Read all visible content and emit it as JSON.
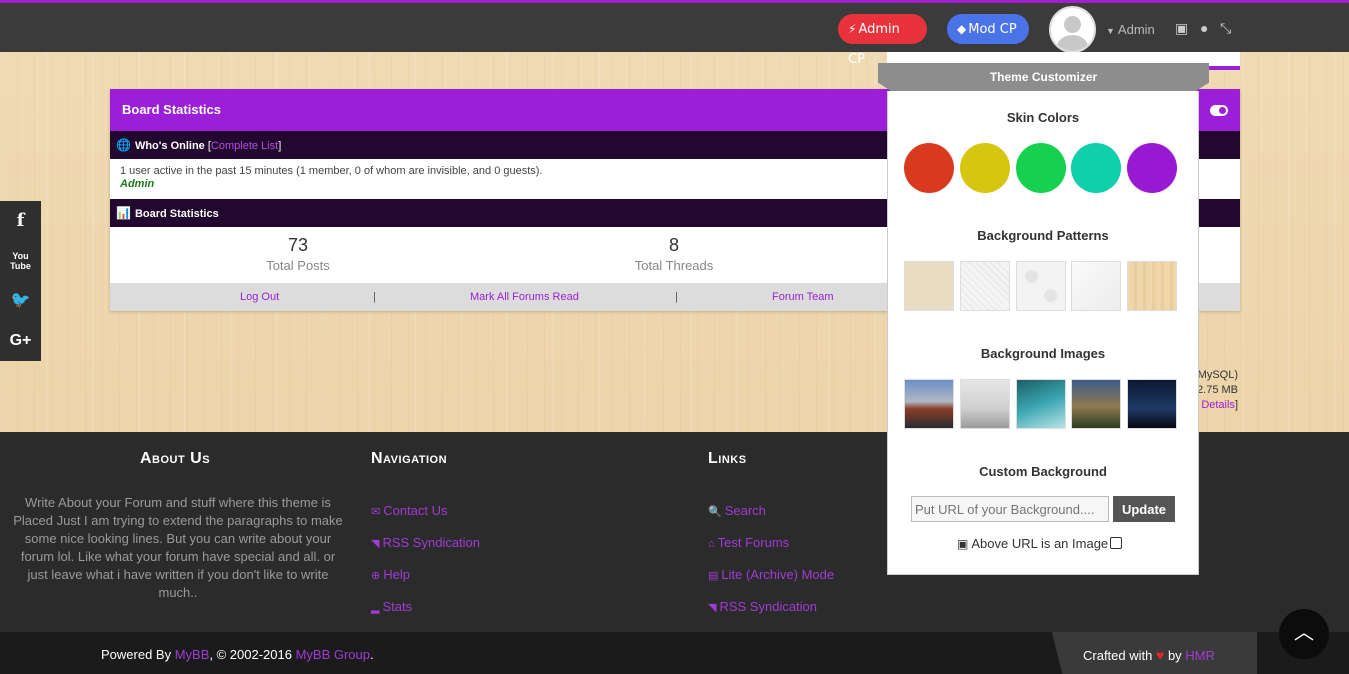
{
  "header": {
    "admin_cp": "Admin CP",
    "mod_cp": "Mod CP",
    "username": "Admin",
    "icons": [
      "image-icon",
      "droplet-icon",
      "compress-icon"
    ]
  },
  "board": {
    "title": "Board Statistics",
    "whos_online_label": "Who's Online",
    "complete_list": "Complete List",
    "online_text": "1 user active in the past 15 minutes (1 member, 0 of whom are invisible, and 0 guests).",
    "online_user": "Admin",
    "stats_label": "Board Statistics",
    "stats": [
      {
        "value": "73",
        "label": "Total Posts"
      },
      {
        "value": "8",
        "label": "Total Threads"
      }
    ],
    "links": [
      "Log Out",
      "Mark All Forums Read",
      "Forum Team"
    ],
    "separator": "|"
  },
  "right_info": {
    "line1": "MySQL)",
    "line2": "2.75 MB",
    "details": "Details"
  },
  "social": [
    "f",
    "You Tube",
    "twitter",
    "G+"
  ],
  "customizer": {
    "tab_title": "Theme Customizer",
    "skin_colors_title": "Skin Colors",
    "skin_colors": [
      "#d93a1f",
      "#d7c60f",
      "#16d14e",
      "#11cfaa",
      "#9918d1"
    ],
    "patterns_title": "Background Patterns",
    "images_title": "Background Images",
    "custom_title": "Custom Background",
    "url_placeholder": "Put URL of your Background....",
    "update_label": "Update",
    "image_check_label": "Above URL is an Image"
  },
  "footer": {
    "about_title": "About Us",
    "about_text": "Write About your Forum and stuff where this theme is Placed Just I am trying to extend the paragraphs to make some nice looking lines. But you can write about your forum lol. Like what your forum have special and all. or just leave what i have written if you don't like to write much..",
    "nav_title": "Navigation",
    "nav_links": [
      "Contact Us",
      "RSS Syndication",
      "Help",
      "Stats"
    ],
    "links_title": "Links",
    "links": [
      "Search",
      "Test Forums",
      "Lite (Archive) Mode",
      "RSS Syndication"
    ],
    "powered_prefix": "Powered By ",
    "mybb": "MyBB",
    "copyright": ", © 2002-2016 ",
    "mybb_group": "MyBB Group",
    "period": ".",
    "crafted_with": "Crafted with",
    "by": "by",
    "author": "HMR"
  },
  "colors": {
    "accent": "#9b1fd6",
    "admin_btn": "#e8323c",
    "mod_btn": "#4a73e8"
  }
}
